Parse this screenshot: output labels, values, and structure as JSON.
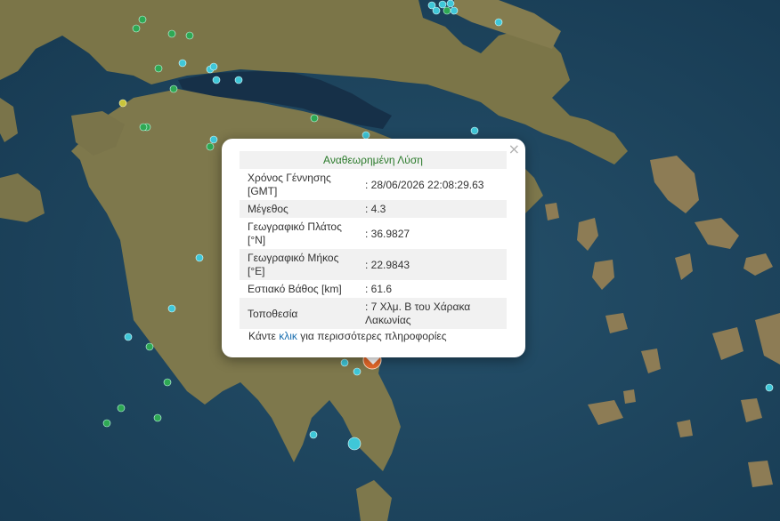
{
  "popup": {
    "title": "Αναθεωρημένη Λύση",
    "rows": [
      {
        "label": "Χρόνος Γέννησης [GMT]",
        "value": ": 28/06/2026 22:08:29.63"
      },
      {
        "label": "Μέγεθος",
        "value": ": 4.3"
      },
      {
        "label": "Γεωγραφικό Πλάτος [°N]",
        "value": ": 36.9827"
      },
      {
        "label": "Γεωγραφικό Μήκος [°E]",
        "value": ": 22.9843"
      },
      {
        "label": "Εστιακό Βάθος [km]",
        "value": ": 61.6"
      },
      {
        "label": "Τοποθεσία",
        "value": ": 7 Χλμ. Β του Χάρακα Λακωνίας"
      }
    ],
    "footer_prefix": "Κάντε",
    "footer_link": "κλικ",
    "footer_suffix": "για περισσότερες πληροφορίες",
    "close_label": "×"
  },
  "colors": {
    "sea": "#1f4a63",
    "land": "#7f7a4e",
    "quake_recent": "#3fc7d8",
    "quake_older": "#2ea854",
    "quake_yellow": "#c9c43a",
    "main_event": "#e8692a"
  }
}
